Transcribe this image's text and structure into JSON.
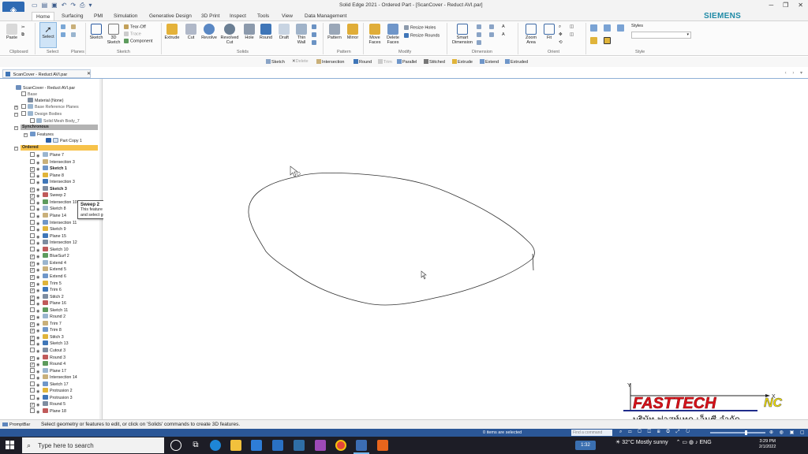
{
  "app": {
    "window_title": "Solid Edge 2021 - Ordered Part - [ScanCover - Reduct AVI.par]",
    "brand": "SIEMENS"
  },
  "tabs": [
    "Home",
    "Surfacing",
    "PMI",
    "Simulation",
    "Generative Design",
    "3D Print",
    "Inspect",
    "Tools",
    "View",
    "Data Management"
  ],
  "ribbon": {
    "groups": [
      "Clipboard",
      "Select",
      "Planes",
      "Sketch",
      "Solids",
      "Intensify",
      "Pattern",
      "Modify",
      "Dimension",
      "Orient",
      "Style"
    ],
    "tools": {
      "paste": "Paste",
      "select": "Select",
      "sketch": "Sketch",
      "sketch3d": "3D Sketch",
      "tear_off": "Tear-Off",
      "trace": "Trace",
      "component": "Component",
      "extrude": "Extrude",
      "cut": "Cut",
      "revolve": "Revolve",
      "revolved_cut": "Revolved Cut",
      "hole": "Hole",
      "round": "Round",
      "draft": "Draft",
      "thin_wall": "Thin Wall",
      "pattern": "Pattern",
      "mirror": "Mirror",
      "move_faces": "Move Faces",
      "delete_faces": "Delete Faces",
      "resize_holes": "Resize Holes",
      "resize_rounds": "Resize Rounds",
      "smart_dimension": "Smart Dimension",
      "zoom_area": "Zoom Area",
      "fit": "Fit",
      "styles": "Styles"
    }
  },
  "command_bar": [
    {
      "label": "Sketch",
      "enabled": true
    },
    {
      "label": "Delete",
      "enabled": false
    },
    {
      "label": "Intersection",
      "enabled": true
    },
    {
      "label": "Round",
      "enabled": true
    },
    {
      "label": "Trim",
      "enabled": false
    },
    {
      "label": "Parallel",
      "enabled": true
    },
    {
      "label": "Stitched",
      "enabled": true
    },
    {
      "label": "Extrude",
      "enabled": true
    },
    {
      "label": "Extend",
      "enabled": true
    },
    {
      "label": "Extruded",
      "enabled": true
    }
  ],
  "document_tab": "ScanCover - Reduct AVI.par",
  "tree": {
    "root": "ScanCover - Reduct AVI.par",
    "top_items": [
      "Base",
      "Material (None)",
      "Base Reference Planes",
      "Design Bodies",
      "Solid Mesh Body_7"
    ],
    "synchronous": "Synchronous",
    "features": "Features",
    "part_copy": "Part Copy 1",
    "ordered": "Ordered",
    "ordered_items": [
      {
        "label": "Plane 7",
        "checked": false,
        "bold": false
      },
      {
        "label": "Intersection 3",
        "checked": false,
        "bold": false
      },
      {
        "label": "Sketch 1",
        "checked": true,
        "bold": true
      },
      {
        "label": "Plane 8",
        "checked": false,
        "bold": false
      },
      {
        "label": "Intersection 3",
        "checked": false,
        "bold": false
      },
      {
        "label": "Sketch 3",
        "checked": true,
        "bold": true
      },
      {
        "label": "Sweep 2",
        "checked": true,
        "bold": false
      },
      {
        "label": "Intersection 10",
        "checked": false,
        "bold": false
      },
      {
        "label": "Sketch 8",
        "checked": false,
        "bold": false
      },
      {
        "label": "Plane 14",
        "checked": false,
        "bold": false
      },
      {
        "label": "Intersection 11",
        "checked": false,
        "bold": false
      },
      {
        "label": "Sketch 9",
        "checked": false,
        "bold": false
      },
      {
        "label": "Plane 15",
        "checked": false,
        "bold": false
      },
      {
        "label": "Intersection 12",
        "checked": false,
        "bold": false
      },
      {
        "label": "Sketch 10",
        "checked": false,
        "bold": false
      },
      {
        "label": "BlueSurf 2",
        "checked": true,
        "bold": false
      },
      {
        "label": "Extend 4",
        "checked": true,
        "bold": false
      },
      {
        "label": "Extend 5",
        "checked": true,
        "bold": false
      },
      {
        "label": "Extend 6",
        "checked": true,
        "bold": false
      },
      {
        "label": "Trim 5",
        "checked": true,
        "bold": false
      },
      {
        "label": "Trim 6",
        "checked": true,
        "bold": false
      },
      {
        "label": "Stitch 2",
        "checked": true,
        "bold": false
      },
      {
        "label": "Plane 16",
        "checked": false,
        "bold": false
      },
      {
        "label": "Sketch 11",
        "checked": false,
        "bold": false
      },
      {
        "label": "Round 2",
        "checked": true,
        "bold": false
      },
      {
        "label": "Trim 7",
        "checked": true,
        "bold": false
      },
      {
        "label": "Trim 8",
        "checked": true,
        "bold": false
      },
      {
        "label": "Stitch 3",
        "checked": true,
        "bold": false
      },
      {
        "label": "Sketch 13",
        "checked": false,
        "bold": false
      },
      {
        "label": "Cutout 3",
        "checked": false,
        "bold": false
      },
      {
        "label": "Round 3",
        "checked": true,
        "bold": false
      },
      {
        "label": "Round 4",
        "checked": true,
        "bold": false
      },
      {
        "label": "Plane 17",
        "checked": false,
        "bold": false
      },
      {
        "label": "Intersection 14",
        "checked": false,
        "bold": false
      },
      {
        "label": "Sketch 17",
        "checked": false,
        "bold": false
      },
      {
        "label": "Protrusion 2",
        "checked": false,
        "bold": false
      },
      {
        "label": "Protrusion 3",
        "checked": false,
        "bold": false
      },
      {
        "label": "Round 5",
        "checked": true,
        "bold": false
      },
      {
        "label": "Plane 18",
        "checked": false,
        "bold": false
      }
    ]
  },
  "tooltip": {
    "title": "Sweep 2",
    "body": "This feature has been rolled back. Right-click on the feature and select goto from the shortcut menu to roll forward."
  },
  "prompt_bar": {
    "label": "PromptBar",
    "message": "Select geometry or features to edit, or click on 'Solids' commands to create 3D features."
  },
  "status": {
    "items_selected": "0 items are selected",
    "find_placeholder": "Find a command"
  },
  "taskbar": {
    "search_placeholder": "Type here to search",
    "chip": "1:32",
    "weather": "32°C  Mostly sunny",
    "language": "ENG",
    "time": "3:29 PM",
    "date": "2/1/2022"
  },
  "watermark": {
    "brand_a": "FASTTECH",
    "brand_b": "NC",
    "company_thai": "บริษัท ฟาสท์เทค เอ็นซี จำกัด"
  },
  "colors": {
    "accent": "#2b5797",
    "siemens": "#1f8aa6",
    "ordered_bar": "#f7c24a",
    "synchronous_bar": "#b3b3b3",
    "logo_red": "#d8121b",
    "logo_yellow": "#f5e100"
  }
}
